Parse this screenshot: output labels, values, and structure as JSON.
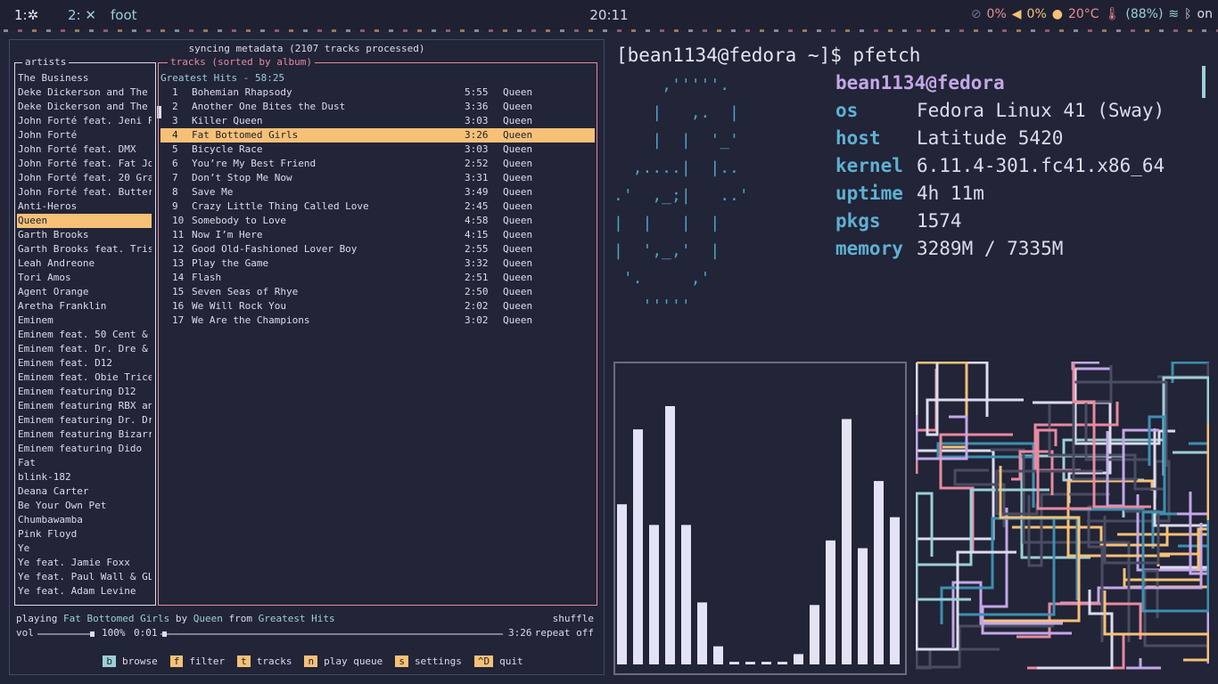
{
  "topbar": {
    "workspace1": "1:",
    "workspace1_icon": "asterisk-icon",
    "workspace2": "2:",
    "workspace2_icon": "close-icon",
    "app": "foot",
    "clock": "20:11",
    "tray": {
      "privacy": "0%",
      "volume": "0%",
      "temp": "20°C",
      "battery": "(88%)",
      "bluetooth": "on"
    }
  },
  "music": {
    "sync_status": "syncing metadata (2107 tracks processed)",
    "artists_title": "artists",
    "tracks_title": "tracks (sorted by album)",
    "album_header": "Greatest Hits - 58:25",
    "artists": [
      "The Business",
      "Deke Dickerson and The ..",
      "Deke Dickerson and The ..",
      "John Forté feat. Jeni F..",
      "John Forté",
      "John Forté feat. DMX",
      "John Forté feat. Fat Joe",
      "John Forté feat. 20 Gra..",
      "John Forté feat. Butter",
      "Anti-Heros",
      "Queen",
      "Garth Brooks",
      "Garth Brooks feat. Tris..",
      "Leah Andreone",
      "Tori Amos",
      "Agent Orange",
      "Aretha Franklin",
      "Eminem",
      "Eminem feat. 50 Cent & ..",
      "Eminem feat. Dr. Dre & ..",
      "Eminem feat. D12",
      "Eminem feat. Obie Trice..",
      "Eminem featuring D12",
      "Eminem featuring RBX an..",
      "Eminem featuring Dr. Dr..",
      "Eminem featuring Bizarre",
      "Eminem featuring Dido",
      "Fat",
      "blink-182",
      "Deana Carter",
      "Be Your Own Pet",
      "Chumbawamba",
      "Pink Floyd",
      "Ye",
      "Ye feat. Jamie Foxx",
      "Ye feat. Paul Wall & GLC",
      "Ye feat. Adam Levine"
    ],
    "selected_artist": 10,
    "tracks": [
      {
        "no": "1",
        "title": "Bohemian Rhapsody",
        "dur": "5:55",
        "artist": "Queen"
      },
      {
        "no": "2",
        "title": "Another One Bites the Dust",
        "dur": "3:36",
        "artist": "Queen"
      },
      {
        "no": "3",
        "title": "Killer Queen",
        "dur": "3:03",
        "artist": "Queen"
      },
      {
        "no": "4",
        "title": "Fat Bottomed Girls",
        "dur": "3:26",
        "artist": "Queen"
      },
      {
        "no": "5",
        "title": "Bicycle Race",
        "dur": "3:03",
        "artist": "Queen"
      },
      {
        "no": "6",
        "title": "You’re My Best Friend",
        "dur": "2:52",
        "artist": "Queen"
      },
      {
        "no": "7",
        "title": "Don’t Stop Me Now",
        "dur": "3:31",
        "artist": "Queen"
      },
      {
        "no": "8",
        "title": "Save Me",
        "dur": "3:49",
        "artist": "Queen"
      },
      {
        "no": "9",
        "title": "Crazy Little Thing Called Love",
        "dur": "2:45",
        "artist": "Queen"
      },
      {
        "no": "10",
        "title": "Somebody to Love",
        "dur": "4:58",
        "artist": "Queen"
      },
      {
        "no": "11",
        "title": "Now I’m Here",
        "dur": "4:15",
        "artist": "Queen"
      },
      {
        "no": "12",
        "title": "Good Old-Fashioned Lover Boy",
        "dur": "2:55",
        "artist": "Queen"
      },
      {
        "no": "13",
        "title": "Play the Game",
        "dur": "3:32",
        "artist": "Queen"
      },
      {
        "no": "14",
        "title": "Flash",
        "dur": "2:51",
        "artist": "Queen"
      },
      {
        "no": "15",
        "title": "Seven Seas of Rhye",
        "dur": "2:50",
        "artist": "Queen"
      },
      {
        "no": "16",
        "title": "We Will Rock You",
        "dur": "2:02",
        "artist": "Queen"
      },
      {
        "no": "17",
        "title": "We Are the Champions",
        "dur": "3:02",
        "artist": "Queen"
      }
    ],
    "selected_track": 3,
    "now_playing": {
      "prefix": "playing",
      "title": "Fat Bottomed Girls",
      "by": "by",
      "artist": "Queen",
      "from": "from",
      "album": "Greatest Hits",
      "shuffle": "shuffle",
      "repeat": "repeat off",
      "vol_label": "vol",
      "volume": "100%",
      "position": "0:01",
      "duration": "3:26",
      "progress_fraction": 0.005
    },
    "keys": [
      {
        "key": "b",
        "label": "browse"
      },
      {
        "key": "f",
        "label": "filter"
      },
      {
        "key": "t",
        "label": "tracks"
      },
      {
        "key": "n",
        "label": "play queue"
      },
      {
        "key": "s",
        "label": "settings"
      },
      {
        "key": "^D",
        "label": "quit"
      }
    ]
  },
  "terminal": {
    "prompt": "[bean1134@fedora ~]$ pfetch",
    "userhost": "bean1134@fedora",
    "logo": "     ,'''''.\n    |   ,.  |\n    |  |  '_'\n  ,....|  |..\n.'  ,_;|   ..'\n|  |   |  |\n|  ',_,'  |\n '.     ,'\n   '''''",
    "info": [
      {
        "key": "os",
        "value": "Fedora Linux 41 (Sway)"
      },
      {
        "key": "host",
        "value": "Latitude 5420"
      },
      {
        "key": "kernel",
        "value": "6.11.4-301.fc41.x86_64"
      },
      {
        "key": "uptime",
        "value": "4h 11m"
      },
      {
        "key": "pkgs",
        "value": "1574"
      },
      {
        "key": "memory",
        "value": "3289M / 7335M"
      }
    ]
  },
  "visualizer": {
    "bar_color": "#e4e3f5",
    "levels": [
      0.62,
      0.91,
      0.54,
      1.0,
      0.54,
      0.24,
      0.07,
      0.01,
      0.01,
      0.01,
      0.01,
      0.04,
      0.23,
      0.48,
      0.95,
      0.45,
      0.71,
      0.57
    ]
  },
  "colors": {
    "background": "#222437",
    "accent_yellow": "#f6c177",
    "accent_cyan": "#9ccfd8",
    "accent_pink": "#e88aa0",
    "accent_purple": "#c4a7e7"
  }
}
